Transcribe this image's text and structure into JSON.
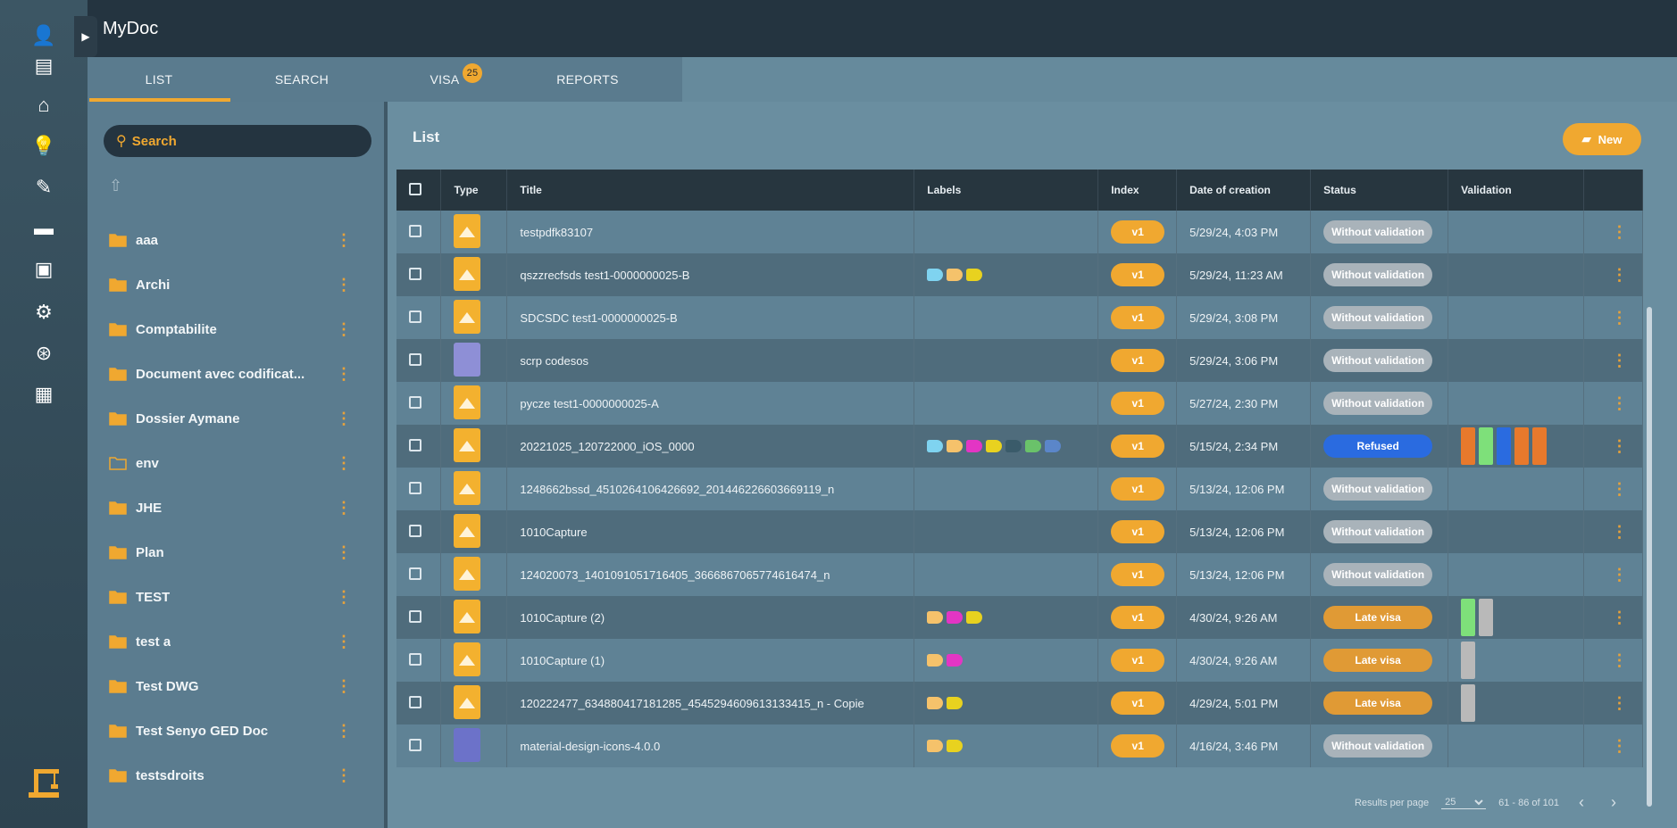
{
  "app": {
    "title": "MyDoc"
  },
  "rail": {
    "items": [
      {
        "name": "user-icon",
        "glyph": "👤"
      },
      {
        "name": "list-icon",
        "glyph": "▤"
      },
      {
        "name": "home-icon",
        "glyph": "⌂"
      },
      {
        "name": "lightbulb-icon",
        "glyph": "💡"
      },
      {
        "name": "pen-icon",
        "glyph": "✎"
      },
      {
        "name": "folder-icon",
        "glyph": "▬"
      },
      {
        "name": "contact-card-icon",
        "glyph": "▣"
      },
      {
        "name": "settings-icon",
        "glyph": "⚙"
      },
      {
        "name": "help-icon",
        "glyph": "⊛"
      },
      {
        "name": "document-icon",
        "glyph": "▦"
      }
    ],
    "logo": "crane-logo-icon"
  },
  "tabs": [
    {
      "label": "LIST",
      "active": true
    },
    {
      "label": "SEARCH",
      "active": false
    },
    {
      "label": "VISA",
      "active": false,
      "badge": "25"
    },
    {
      "label": "REPORTS",
      "active": false
    }
  ],
  "folders": {
    "search_placeholder": "Search",
    "items": [
      {
        "name": "aaa",
        "type": "folder"
      },
      {
        "name": "Archi",
        "type": "folder"
      },
      {
        "name": "Comptabilite",
        "type": "folder"
      },
      {
        "name": "Document avec codificat...",
        "type": "folder"
      },
      {
        "name": "Dossier Aymane",
        "type": "folder"
      },
      {
        "name": "env",
        "type": "folder-outline"
      },
      {
        "name": "JHE",
        "type": "folder"
      },
      {
        "name": "Plan",
        "type": "folder"
      },
      {
        "name": "TEST",
        "type": "folder"
      },
      {
        "name": "test a",
        "type": "folder"
      },
      {
        "name": "Test DWG",
        "type": "folder"
      },
      {
        "name": "Test Senyo GED Doc",
        "type": "folder"
      },
      {
        "name": "testsdroits",
        "type": "folder"
      }
    ]
  },
  "main": {
    "title": "List",
    "new_button": "New",
    "columns": [
      "",
      "Type",
      "Title",
      "Labels",
      "Index",
      "Date of creation",
      "Status",
      "Validation",
      ""
    ],
    "rows": [
      {
        "type": "img",
        "title": "testpdfk83107",
        "tags": [],
        "index": "v1",
        "date": "5/29/24, 4:03 PM",
        "status": "Without validation",
        "status_kind": "without",
        "validation": []
      },
      {
        "type": "img",
        "title": "qszzrecfsds test1-0000000025-B",
        "tags": [
          "#7fd3f0",
          "#f5c26b",
          "#e8d21f"
        ],
        "index": "v1",
        "date": "5/29/24, 11:23 AM",
        "status": "Without validation",
        "status_kind": "without",
        "validation": []
      },
      {
        "type": "img",
        "title": "SDCSDC test1-0000000025-B",
        "tags": [],
        "index": "v1",
        "date": "5/29/24, 3:08 PM",
        "status": "Without validation",
        "status_kind": "without",
        "validation": []
      },
      {
        "type": "txt",
        "title": "scrp codesos",
        "tags": [],
        "index": "v1",
        "date": "5/29/24, 3:06 PM",
        "status": "Without validation",
        "status_kind": "without",
        "validation": []
      },
      {
        "type": "img",
        "title": "pycze test1-0000000025-A",
        "tags": [],
        "index": "v1",
        "date": "5/27/24, 2:30 PM",
        "status": "Without validation",
        "status_kind": "without",
        "validation": []
      },
      {
        "type": "img",
        "title": "20221025_120722000_iOS_0000",
        "tags": [
          "#7fd3f0",
          "#f5c26b",
          "#e335c4",
          "#e8d21f",
          "#3a5b6a",
          "#6ac26a",
          "#5b86c9"
        ],
        "index": "v1",
        "date": "5/15/24, 2:34 PM",
        "status": "Refused",
        "status_kind": "refused",
        "validation": [
          "#e8792c",
          "#7ee07a",
          "#2a6be0",
          "#e8792c",
          "#e8792c"
        ]
      },
      {
        "type": "img",
        "title": "1248662bssd_4510264106426692_201446226603669119_n",
        "tags": [],
        "index": "v1",
        "date": "5/13/24, 12:06 PM",
        "status": "Without validation",
        "status_kind": "without",
        "validation": []
      },
      {
        "type": "img",
        "title": "1010Capture",
        "tags": [],
        "index": "v1",
        "date": "5/13/24, 12:06 PM",
        "status": "Without validation",
        "status_kind": "without",
        "validation": []
      },
      {
        "type": "img",
        "title": "124020073_1401091051716405_3666867065774616474_n",
        "tags": [],
        "index": "v1",
        "date": "5/13/24, 12:06 PM",
        "status": "Without validation",
        "status_kind": "without",
        "validation": []
      },
      {
        "type": "img",
        "title": "1010Capture (2)",
        "tags": [
          "#f5c26b",
          "#e335c4",
          "#e8d21f"
        ],
        "index": "v1",
        "date": "4/30/24, 9:26 AM",
        "status": "Late visa",
        "status_kind": "late",
        "validation": [
          "#7ee07a",
          "#b9b9b9"
        ]
      },
      {
        "type": "img",
        "title": "1010Capture (1)",
        "tags": [
          "#f5c26b",
          "#e335c4"
        ],
        "index": "v1",
        "date": "4/30/24, 9:26 AM",
        "status": "Late visa",
        "status_kind": "late",
        "validation": [
          "#b9b9b9"
        ]
      },
      {
        "type": "img",
        "title": "120222477_634880417181285_4545294609613133415_n - Copie",
        "tags": [
          "#f5c26b",
          "#e8d21f"
        ],
        "index": "v1",
        "date": "4/29/24, 5:01 PM",
        "status": "Late visa",
        "status_kind": "late",
        "validation": [
          "#b9b9b9"
        ]
      },
      {
        "type": "zip",
        "title": "material-design-icons-4.0.0",
        "tags": [
          "#f5c26b",
          "#e8d21f"
        ],
        "index": "v1",
        "date": "4/16/24, 3:46 PM",
        "status": "Without validation",
        "status_kind": "without",
        "validation": []
      }
    ],
    "footer": {
      "per_page_label": "Results per page",
      "per_page_value": "25",
      "range": "61 - 86 of 101"
    }
  },
  "colors": {
    "accent": "#f0a830",
    "refused": "#2a6be0",
    "late": "#e09a35",
    "without": "#a9b3ba",
    "topbar": "#243440"
  }
}
